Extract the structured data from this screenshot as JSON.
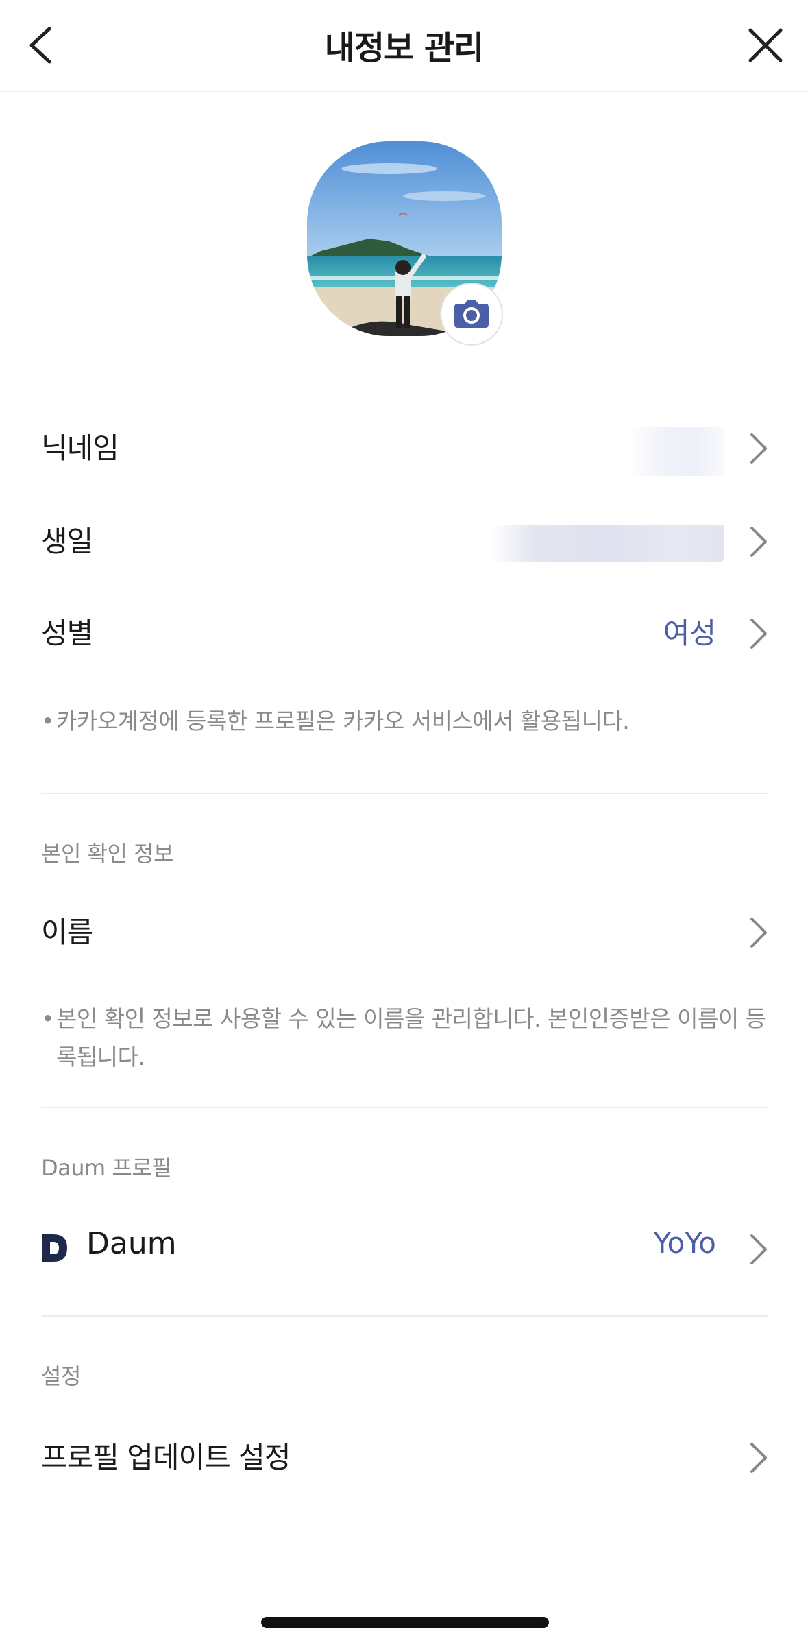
{
  "header": {
    "title": "내정보 관리",
    "back_icon": "chevron-left-icon",
    "close_icon": "close-icon"
  },
  "profile": {
    "camera_icon": "camera-icon"
  },
  "rows": {
    "nickname": {
      "label": "닉네임"
    },
    "birthday": {
      "label": "생일"
    },
    "gender": {
      "label": "성별",
      "value": "여성"
    }
  },
  "notes": {
    "profile_note": "카카오계정에 등록한 프로필은 카카오 서비스에서 활용됩니다.",
    "identity_note": "본인 확인 정보로 사용할 수 있는 이름을 관리합니다. 본인인증받은 이름이 등록됩니다."
  },
  "sections": {
    "identity": {
      "label": "본인 확인 정보",
      "name_label": "이름"
    },
    "daum": {
      "label": "Daum 프로필",
      "service_label": "Daum",
      "value": "YoYo"
    },
    "settings": {
      "label": "설정",
      "update_label": "프로필 업데이트 설정"
    }
  },
  "colors": {
    "accent": "#4a5fa8",
    "muted_text": "#8a8a8a",
    "divider": "#ececec"
  }
}
